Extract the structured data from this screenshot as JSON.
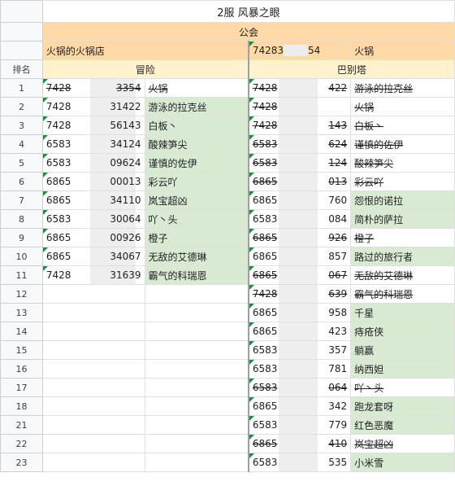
{
  "sheet_title": "2服 风暴之眼",
  "guild_label": "公会",
  "left_guild": "火锅的火锅店",
  "right_guild_id_start": "74283",
  "right_guild_id_end": "54",
  "right_guild_name": "火锅",
  "rank_header": "排名",
  "left_section": "冒险",
  "right_section": "巴别塔",
  "rows": [
    {
      "rank": "1",
      "l_id_start": "7428",
      "l_id_end": "3354",
      "l_name": "火锅",
      "l_struck": true,
      "r_id_start": "7428",
      "r_id_end": "422",
      "r_name": "游泳的拉克丝",
      "r_struck": true
    },
    {
      "rank": "2",
      "l_id_start": "7428",
      "l_id_end": "31422",
      "l_name": "游泳的拉克丝",
      "l_struck": false,
      "r_id_start": "7428",
      "r_id_end": "",
      "r_name": "火锅",
      "r_struck": true
    },
    {
      "rank": "3",
      "l_id_start": "7428",
      "l_id_end": "56143",
      "l_name": "白板丶",
      "l_struck": false,
      "r_id_start": "7428",
      "r_id_end": "143",
      "r_name": "白板丶",
      "r_struck": true
    },
    {
      "rank": "4",
      "l_id_start": "6583",
      "l_id_end": "34124",
      "l_name": "酸辣笋尖",
      "l_struck": false,
      "r_id_start": "6583",
      "r_id_end": "624",
      "r_name": "谨慎的佐伊",
      "r_struck": true
    },
    {
      "rank": "5",
      "l_id_start": "6583",
      "l_id_end": "09624",
      "l_name": "谨慎的佐伊",
      "l_struck": false,
      "r_id_start": "6583",
      "r_id_end": "124",
      "r_name": "酸辣笋尖",
      "r_struck": true
    },
    {
      "rank": "6",
      "l_id_start": "6865",
      "l_id_end": "00013",
      "l_name": "彩云吖",
      "l_struck": false,
      "r_id_start": "6865",
      "r_id_end": "013",
      "r_name": "彩云吖",
      "r_struck": true
    },
    {
      "rank": "7",
      "l_id_start": "6865",
      "l_id_end": "34110",
      "l_name": "岚宝超凶",
      "l_struck": false,
      "r_id_start": "6865",
      "r_id_end": "760",
      "r_name": "怨恨的诺拉",
      "r_struck": false
    },
    {
      "rank": "8",
      "l_id_start": "6583",
      "l_id_end": "30064",
      "l_name": "吖丶头",
      "l_struck": false,
      "r_id_start": "6583",
      "r_id_end": "084",
      "r_name": "简朴的萨拉",
      "r_struck": false
    },
    {
      "rank": "9",
      "l_id_start": "6865",
      "l_id_end": "00926",
      "l_name": "橙子",
      "l_struck": false,
      "r_id_start": "6865",
      "r_id_end": "926",
      "r_name": "橙子",
      "r_struck": true
    },
    {
      "rank": "10",
      "l_id_start": "6865",
      "l_id_end": "34067",
      "l_name": "无敌的艾德琳",
      "l_struck": false,
      "r_id_start": "6865",
      "r_id_end": "857",
      "r_name": "路过的旅行者",
      "r_struck": false
    },
    {
      "rank": "11",
      "l_id_start": "7428",
      "l_id_end": "31639",
      "l_name": "霸气的科瑞恩",
      "l_struck": false,
      "r_id_start": "6865",
      "r_id_end": "067",
      "r_name": "无敌的艾德琳",
      "r_struck": true
    },
    {
      "rank": "12",
      "r_id_start": "7428",
      "r_id_end": "639",
      "r_name": "霸气的科瑞恩",
      "r_struck": true
    },
    {
      "rank": "13",
      "r_id_start": "6865",
      "r_id_end": "958",
      "r_name": "千星",
      "r_struck": false
    },
    {
      "rank": "14",
      "r_id_start": "6865",
      "r_id_end": "423",
      "r_name": "痔疮侠",
      "r_struck": false
    },
    {
      "rank": "15",
      "r_id_start": "6583",
      "r_id_end": "357",
      "r_name": "躺赢",
      "r_struck": false
    },
    {
      "rank": "16",
      "r_id_start": "6583",
      "r_id_end": "781",
      "r_name": "纳西妲",
      "r_struck": false
    },
    {
      "rank": "17",
      "r_id_start": "6583",
      "r_id_end": "064",
      "r_name": "吖丶头",
      "r_struck": true
    },
    {
      "rank": "18",
      "r_id_start": "6865",
      "r_id_end": "342",
      "r_name": "跑龙套呀",
      "r_struck": false
    },
    {
      "rank": "21",
      "r_id_start": "6583",
      "r_id_end": "779",
      "r_name": "红色恶魔",
      "r_struck": false
    },
    {
      "rank": "22",
      "r_id_start": "6865",
      "r_id_end": "410",
      "r_name": "岚宝超凶",
      "r_struck": true
    },
    {
      "rank": "23",
      "r_id_start": "6583",
      "r_id_end": "535",
      "r_name": "小米雪",
      "r_struck": false
    }
  ]
}
